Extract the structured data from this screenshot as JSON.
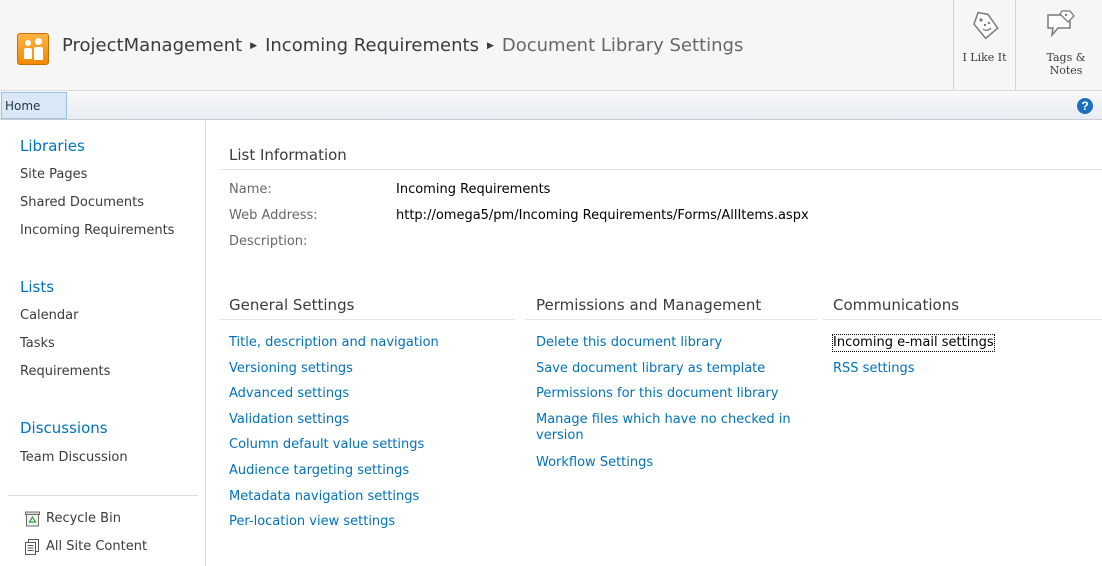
{
  "header": {
    "breadcrumb": [
      {
        "label": "ProjectManagement"
      },
      {
        "label": "Incoming Requirements"
      },
      {
        "label": "Document Library Settings"
      }
    ],
    "separator": "▶",
    "social": {
      "like_label": "I Like It",
      "tags_label_line1": "Tags &",
      "tags_label_line2": "Notes"
    }
  },
  "ribbon": {
    "home_tab": "Home",
    "help_glyph": "?"
  },
  "quick_launch": {
    "libraries": {
      "heading": "Libraries",
      "items": [
        "Site Pages",
        "Shared Documents",
        "Incoming Requirements"
      ]
    },
    "lists": {
      "heading": "Lists",
      "items": [
        "Calendar",
        "Tasks",
        "Requirements"
      ]
    },
    "discussions": {
      "heading": "Discussions",
      "items": [
        "Team Discussion"
      ]
    },
    "recycle_bin": "Recycle Bin",
    "all_site_content": "All Site Content"
  },
  "list_information": {
    "title": "List Information",
    "name_label": "Name:",
    "name_value": "Incoming Requirements",
    "web_address_label": "Web Address:",
    "web_address_value": "http://omega5/pm/Incoming Requirements/Forms/AllItems.aspx",
    "description_label": "Description:"
  },
  "general_settings": {
    "title": "General Settings",
    "links": [
      "Title, description and navigation",
      "Versioning settings",
      "Advanced settings",
      "Validation settings",
      "Column default value settings",
      "Audience targeting settings",
      "Metadata navigation settings",
      "Per-location view settings"
    ]
  },
  "permissions_management": {
    "title": "Permissions and Management",
    "links": [
      "Delete this document library",
      "Save document library as template",
      "Permissions for this document library",
      "Manage files which have no checked in version",
      "Workflow Settings"
    ]
  },
  "communications": {
    "title": "Communications",
    "links": [
      "Incoming e-mail settings",
      "RSS settings"
    ]
  },
  "colors": {
    "link": "#0072bc",
    "heading_link": "#0072bc",
    "text": "#3b3b3b",
    "title_bar_bg": "#f6f6f6",
    "tab_selected_bg": "#d9e7f6",
    "logo_orange": "#f08a00",
    "help_blue": "#1f6fbf"
  },
  "icons": {
    "site_logo": "people-icon",
    "like": "tag-smile-icon",
    "tags": "tag-note-icon",
    "help": "help-icon",
    "recycle_bin": "recycle-bin-icon",
    "all_site_content": "document-icon"
  }
}
